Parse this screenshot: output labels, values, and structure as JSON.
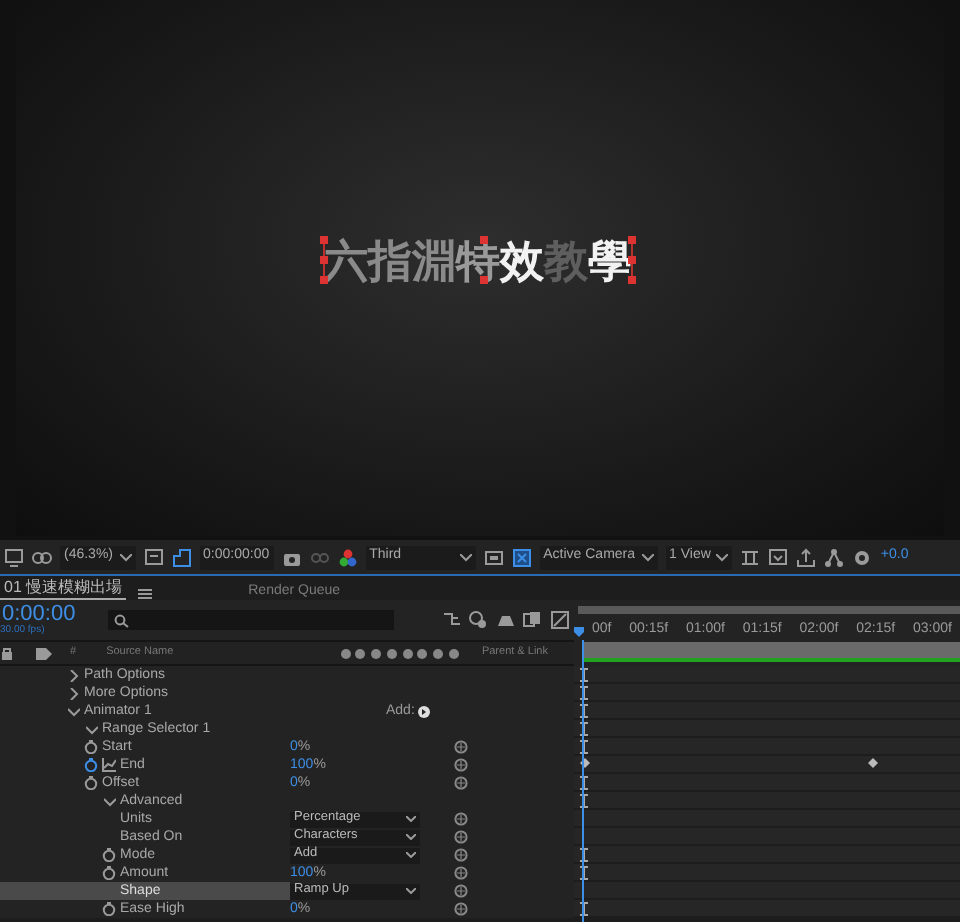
{
  "viewer": {
    "title_chars": [
      {
        "char": "六",
        "color": "#8a8a8a"
      },
      {
        "char": "指",
        "color": "#8a8a8a"
      },
      {
        "char": "淵",
        "color": "#8a8a8a"
      },
      {
        "char": "特",
        "color": "#9a9a9a"
      },
      {
        "char": "效",
        "color": "#f2f2f2"
      },
      {
        "char": "教",
        "color": "#5e5e5e"
      },
      {
        "char": "學",
        "color": "#f2f2f2"
      }
    ]
  },
  "viewer_toolbar": {
    "zoom": "(46.3%)",
    "timecode": "0:00:00:00",
    "resolution": "Third",
    "camera": "Active Camera",
    "views": "1 View",
    "exposure": "+0.0"
  },
  "tabs": [
    {
      "label": "01 慢速模糊出場",
      "selected": true
    },
    {
      "label": "Render Queue",
      "selected": false
    }
  ],
  "timeline": {
    "current_time": "0:00:00",
    "fps": "30.00 fps)",
    "columns": {
      "number": "#",
      "source": "Source Name",
      "parent": "Parent & Link"
    },
    "ruler": [
      "00f",
      "00:15f",
      "01:00f",
      "01:15f",
      "02:00f",
      "02:15f",
      "03:00f"
    ],
    "properties": [
      {
        "kind": "group",
        "label": "Path Options",
        "expanded": false
      },
      {
        "kind": "group",
        "label": "More Options",
        "expanded": false
      },
      {
        "kind": "group",
        "label": "Animator 1",
        "expanded": true,
        "add_label": "Add:",
        "children": [
          {
            "kind": "group",
            "label": "Range Selector 1",
            "expanded": true,
            "children": [
              {
                "kind": "number",
                "label": "Start",
                "value": "0",
                "unit": "%",
                "keyframed": false
              },
              {
                "kind": "number",
                "label": "End",
                "value": "100",
                "unit": "%",
                "keyframed": true
              },
              {
                "kind": "number",
                "label": "Offset",
                "value": "0",
                "unit": "%",
                "keyframed": false
              },
              {
                "kind": "group",
                "label": "Advanced",
                "expanded": true,
                "children": [
                  {
                    "kind": "dropdown",
                    "label": "Units",
                    "value": "Percentage",
                    "stopwatch": false,
                    "selected": false
                  },
                  {
                    "kind": "dropdown",
                    "label": "Based On",
                    "value": "Characters",
                    "stopwatch": false,
                    "selected": false
                  },
                  {
                    "kind": "dropdown",
                    "label": "Mode",
                    "value": "Add",
                    "stopwatch": true,
                    "selected": false
                  },
                  {
                    "kind": "number",
                    "label": "Amount",
                    "value": "100",
                    "unit": "%",
                    "keyframed": false
                  },
                  {
                    "kind": "dropdown",
                    "label": "Shape",
                    "value": "Ramp Up",
                    "stopwatch": false,
                    "selected": true
                  },
                  {
                    "kind": "number",
                    "label": "Ease High",
                    "value": "0",
                    "unit": "%",
                    "keyframed": false
                  }
                ]
              }
            ]
          }
        ]
      }
    ]
  }
}
